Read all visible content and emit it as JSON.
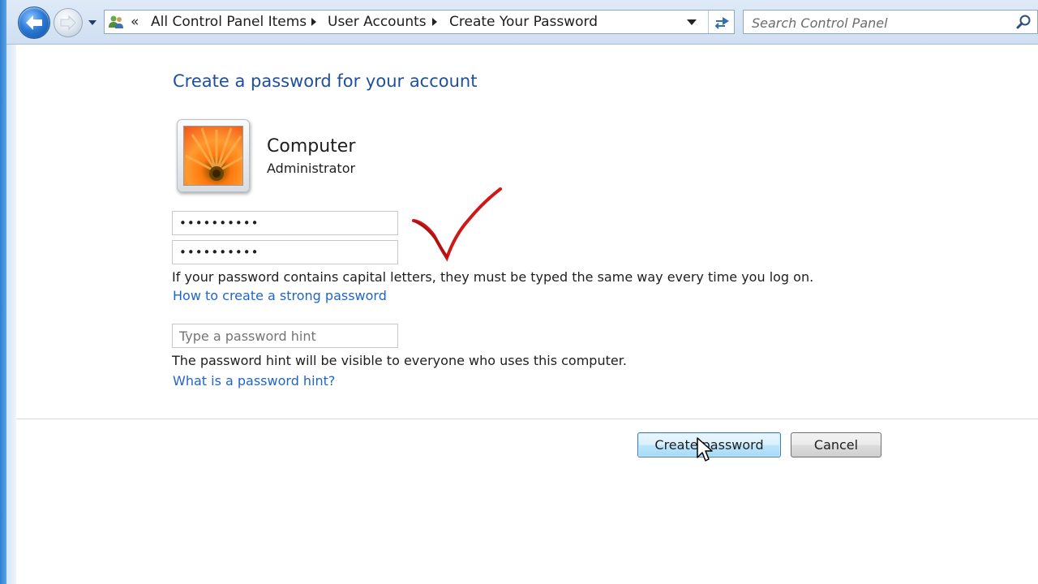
{
  "address_bar": {
    "overflow_chevron": "«",
    "breadcrumbs": [
      "All Control Panel Items",
      "User Accounts",
      "Create Your Password"
    ]
  },
  "search": {
    "placeholder": "Search Control Panel"
  },
  "page": {
    "heading": "Create a password for your account"
  },
  "account": {
    "name": "Computer",
    "role": "Administrator"
  },
  "form": {
    "new_password_value": "••••••••••",
    "confirm_password_value": "••••••••••",
    "capital_letters_note": "If your password contains capital letters, they must be typed the same way every time you log on.",
    "strong_password_link": "How to create a strong password",
    "hint_placeholder": "Type a password hint",
    "hint_note": "The password hint will be visible to everyone who uses this computer.",
    "hint_help_link": "What is a password hint?"
  },
  "buttons": {
    "create_label": "Create password",
    "cancel_label": "Cancel"
  },
  "colors": {
    "heading": "#1e4fa0",
    "link": "#1f66c9",
    "checkmark": "#d01818"
  }
}
